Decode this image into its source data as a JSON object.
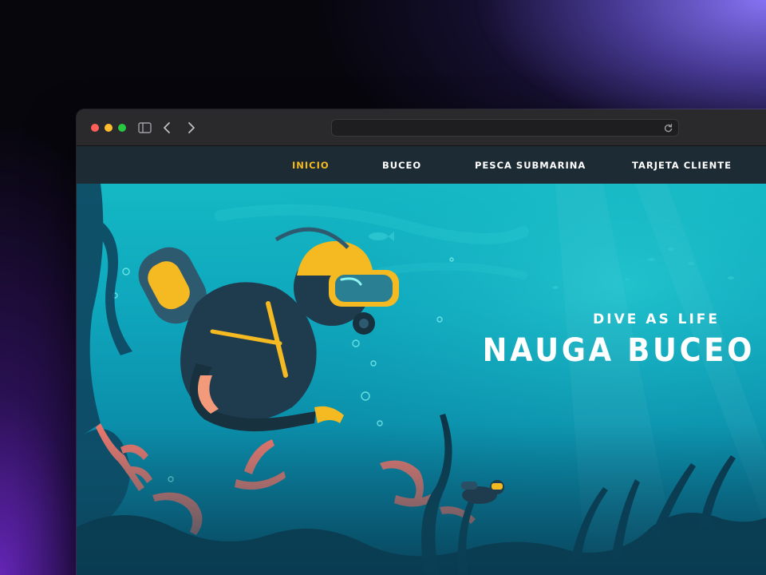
{
  "nav": {
    "items": [
      {
        "label": "INICIO",
        "active": true
      },
      {
        "label": "BUCEO",
        "active": false
      },
      {
        "label": "PESCA SUBMARINA",
        "active": false
      },
      {
        "label": "TARJETA CLIENTE",
        "active": false
      }
    ],
    "active_color": "#f5b921"
  },
  "hero": {
    "tagline": "DIVE AS LIFE",
    "title": "NAUGA BUCEO"
  },
  "colors": {
    "water": "#0fa7bd",
    "coral": "#f0766a",
    "suit": "#1f3c4f",
    "accent": "#f5b921"
  }
}
